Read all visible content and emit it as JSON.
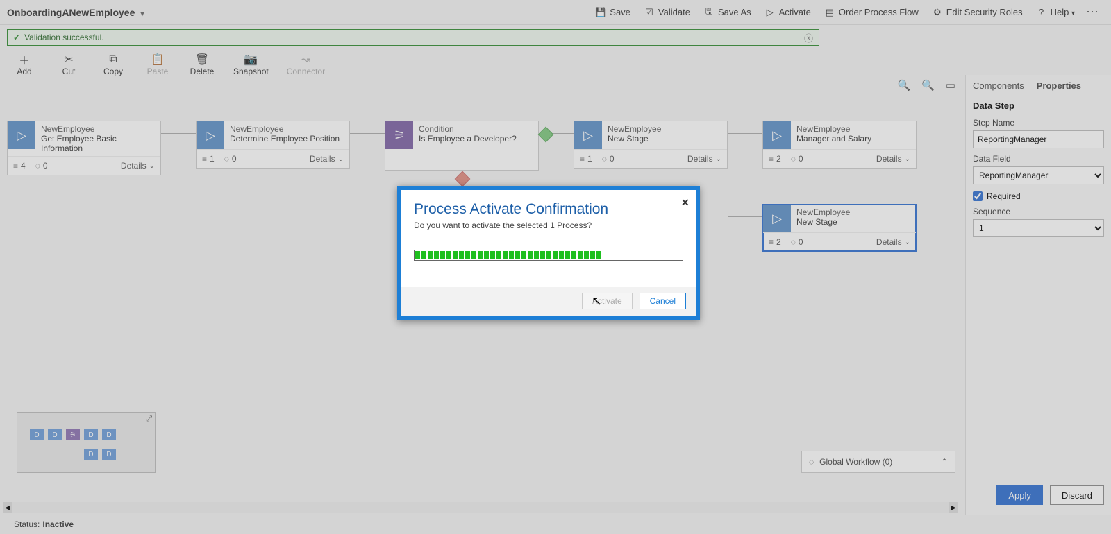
{
  "header": {
    "title": "OnboardingANewEmployee",
    "save": "Save",
    "validate": "Validate",
    "saveAs": "Save As",
    "activate": "Activate",
    "orderProcessFlow": "Order Process Flow",
    "editSecurityRoles": "Edit Security Roles",
    "help": "Help"
  },
  "validation": {
    "message": "Validation successful."
  },
  "toolbar": {
    "add": "Add",
    "cut": "Cut",
    "copy": "Copy",
    "paste": "Paste",
    "delete": "Delete",
    "snapshot": "Snapshot",
    "connector": "Connector"
  },
  "nodes": {
    "n1": {
      "title": "NewEmployee",
      "sub": "Get Employee Basic Information",
      "steps": "4",
      "wf": "0",
      "details": "Details"
    },
    "n2": {
      "title": "NewEmployee",
      "sub": "Determine Employee Position",
      "steps": "1",
      "wf": "0",
      "details": "Details"
    },
    "n3": {
      "title": "Condition",
      "sub": "Is Employee a Developer?"
    },
    "n4": {
      "title": "NewEmployee",
      "sub": "New Stage",
      "steps": "1",
      "wf": "0",
      "details": "Details"
    },
    "n5": {
      "title": "NewEmployee",
      "sub": "Manager and Salary",
      "steps": "2",
      "wf": "0",
      "details": "Details"
    },
    "n6": {
      "title": "NewEmployee",
      "sub": "New Stage",
      "steps": "2",
      "wf": "0",
      "details": "Details"
    }
  },
  "globalWorkflow": {
    "label": "Global Workflow (0)"
  },
  "statusbar": {
    "label": "Status:",
    "value": "Inactive"
  },
  "panel": {
    "tabComponents": "Components",
    "tabProperties": "Properties",
    "section": "Data Step",
    "stepNameLabel": "Step Name",
    "stepNameValue": "ReportingManager",
    "dataFieldLabel": "Data Field",
    "dataFieldValue": "ReportingManager",
    "requiredLabel": "Required",
    "sequenceLabel": "Sequence",
    "sequenceValue": "1",
    "apply": "Apply",
    "discard": "Discard"
  },
  "modal": {
    "title": "Process Activate Confirmation",
    "sub": "Do you want to activate the selected 1 Process?",
    "activate": "Activate",
    "cancel": "Cancel"
  }
}
